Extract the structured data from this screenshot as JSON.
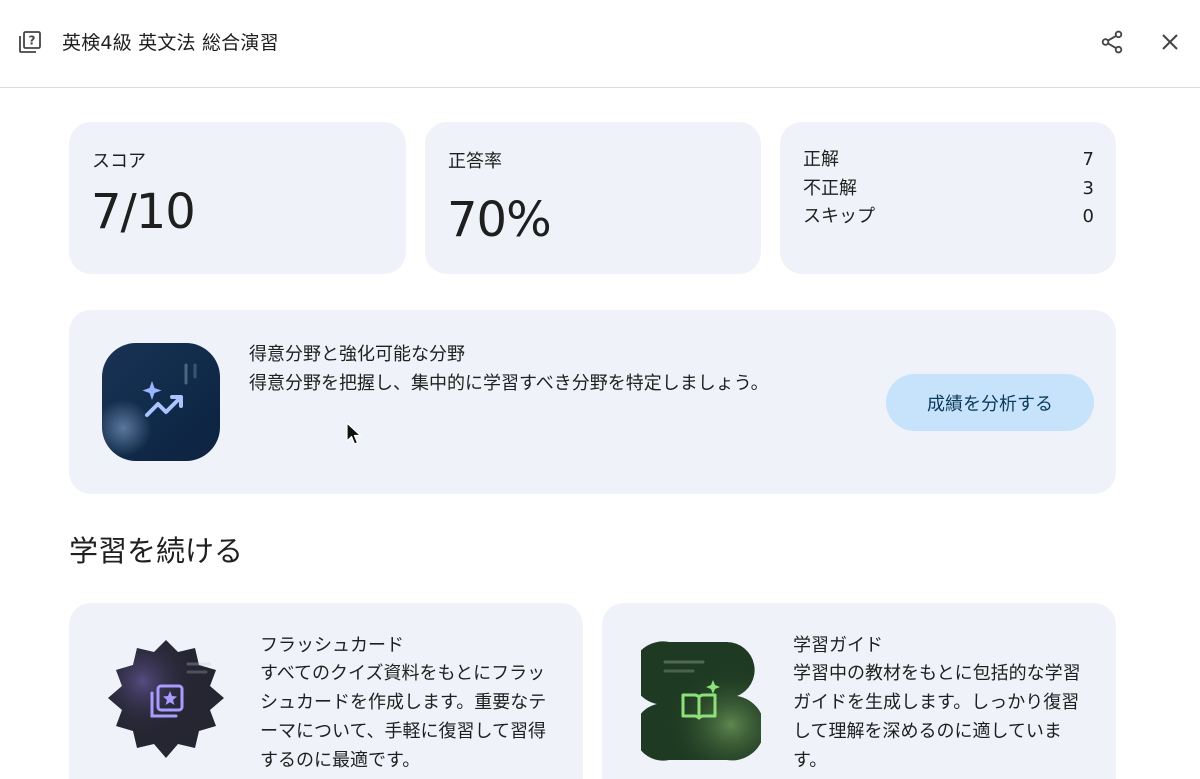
{
  "header": {
    "title": "英検4級 英文法 総合演習",
    "quiz_icon": "quiz-icon",
    "share_icon": "share-icon",
    "close_icon": "close-icon"
  },
  "stats": {
    "score": {
      "label": "スコア",
      "value": "7/10"
    },
    "accuracy": {
      "label": "正答率",
      "value": "70%"
    },
    "tally": [
      {
        "label": "正解",
        "count": "7"
      },
      {
        "label": "不正解",
        "count": "3"
      },
      {
        "label": "スキップ",
        "count": "0"
      }
    ]
  },
  "analysis": {
    "title": "得意分野と強化可能な分野",
    "description": "得意分野を把握し、集中的に学習すべき分野を特定しましょう。",
    "button_label": "成績を分析する",
    "icon": "trending-up-sparkle-icon"
  },
  "continue_section": {
    "heading": "学習を続ける",
    "tools": [
      {
        "title": "フラッシュカード",
        "description": "すべてのクイズ資料をもとにフラッシュカードを作成します。重要なテーマについて、手軽に復習して習得するのに最適です。",
        "icon": "flashcards-icon"
      },
      {
        "title": "学習ガイド",
        "description": "学習中の教材をもとに包括的な学習ガイドを生成します。しっかり復習して理解を深めるのに適しています。",
        "icon": "study-guide-book-icon"
      }
    ]
  },
  "colors": {
    "card_bg": "#eff3f9",
    "button_bg": "#c7e3fb",
    "analysis_tile": "#102a49",
    "flashcard_tile": "#262633",
    "guide_tile": "#1e3a22"
  }
}
